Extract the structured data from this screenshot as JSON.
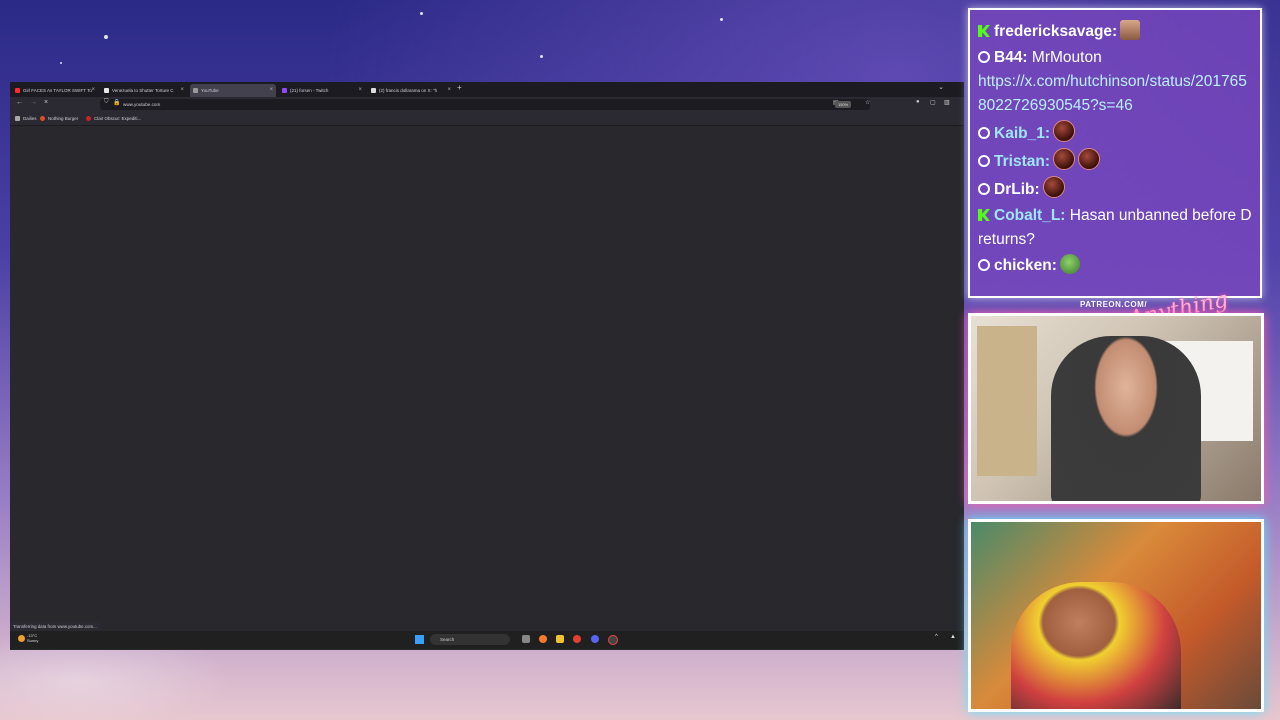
{
  "browser": {
    "tabs": [
      {
        "label": "Girl FACES As TAYLOR SWIFT To",
        "fav_color": "#ff2a2a"
      },
      {
        "label": "Venezuela to Shutter Torture C",
        "fav_color": "#e8e8e8"
      },
      {
        "label": "YouTube",
        "fav_color": "#999999",
        "active": true
      },
      {
        "label": "(21) forsen - Twitch",
        "fav_color": "#9146ff"
      },
      {
        "label": "(2) francis dollarama on X: \"h",
        "fav_color": "#dddddd"
      }
    ],
    "url": "www.youtube.com",
    "zoom": "150%",
    "bookmarks": [
      {
        "label": "Dailies",
        "color": "#aaaaaa"
      },
      {
        "label": "Nothing Burger",
        "color": "#e04a2a"
      },
      {
        "label": "Clair Obscur: Expediti...",
        "color": "#cc2222"
      }
    ],
    "status_text": "Transferring data from www.youtube.com..."
  },
  "taskbar": {
    "temperature": "-13°C",
    "weather": "Sunny",
    "search_placeholder": "Search"
  },
  "chat": {
    "messages": [
      {
        "badge": "kick",
        "user": "fredericksavage:",
        "user_style": "white",
        "text": "",
        "emotes": [
          "face"
        ]
      },
      {
        "badge": "dot",
        "user": "B44:",
        "user_style": "white",
        "text": "MrMouton",
        "emotes": []
      },
      {
        "badge": "",
        "user": "",
        "user_style": "white",
        "text": "https://x.com/hutchinson/status/2017658022726930545?s=46",
        "link": true,
        "emotes": []
      },
      {
        "badge": "dot",
        "user": "Kaib_1:",
        "user_style": "blue",
        "text": "",
        "emotes": [
          "ball"
        ]
      },
      {
        "badge": "dot",
        "user": "Tristan:",
        "user_style": "blue",
        "text": "",
        "emotes": [
          "ball",
          "ball"
        ]
      },
      {
        "badge": "dot",
        "user": "DrLib:",
        "user_style": "white",
        "text": "",
        "emotes": [
          "ball"
        ]
      },
      {
        "badge": "kick",
        "user": "Cobalt_L:",
        "user_style": "blue",
        "text": "Hasan unbanned before D returns?",
        "emotes": []
      },
      {
        "badge": "dot",
        "user": "chicken:",
        "user_style": "white",
        "text": "",
        "emotes": [
          "frog"
        ]
      }
    ]
  },
  "overlay": {
    "patreon_label": "PATREON.COM/",
    "signature": "Anything else?"
  }
}
